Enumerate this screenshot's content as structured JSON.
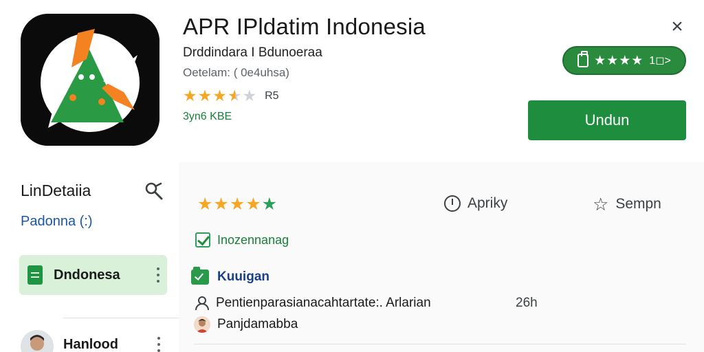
{
  "app": {
    "title": "APR IPldatim Indonesia",
    "developer": "Drddindara I Bdunoeraa",
    "meta": "Oetelam: ( 0e4uhsa)",
    "rating_count": "R5",
    "rating": 3.5,
    "size_line": "3yn6 KBE",
    "close_label": "×",
    "install_label": "Undun"
  },
  "badge": {
    "stars": "★★★★",
    "text": "1◻>"
  },
  "sidebar": {
    "title": "LinDetaiia",
    "subtitle": "Padonna (:)",
    "active_item": "Dndonesa",
    "user_name": "Hanlood"
  },
  "main": {
    "stars": "★★★★",
    "last_star": "★",
    "apply_label": "Apriky",
    "save_label": "Sempn",
    "check_label": "Inozennanag",
    "section_title": "Kuuigan",
    "items": [
      {
        "text": "Pentienparasianacahtartate:. Arlarian",
        "time": "26h"
      },
      {
        "text": "Panjdamabba"
      }
    ]
  },
  "colors": {
    "accent": "#1e8e3e",
    "star": "#f5a623",
    "link": "#1a56a8"
  },
  "icons": [
    "app-logo-icon",
    "close-icon",
    "clipboard-icon",
    "search-icon",
    "document-icon",
    "clock-icon",
    "star-outline-icon",
    "checkbox-icon",
    "folder-check-icon",
    "people-icon"
  ]
}
